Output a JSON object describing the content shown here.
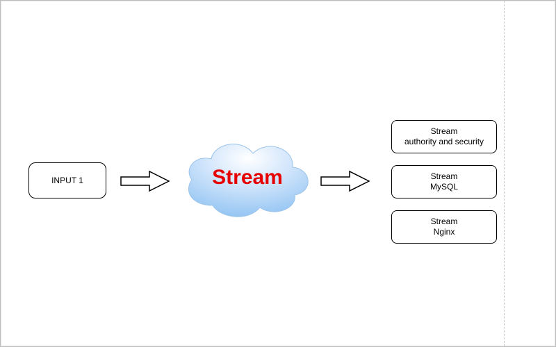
{
  "input": {
    "label": "INPUT 1"
  },
  "cloud": {
    "label": "Stream"
  },
  "outputs": [
    {
      "title": "Stream",
      "subtitle": "authority and security"
    },
    {
      "title": "Stream",
      "subtitle": "MySQL"
    },
    {
      "title": "Stream",
      "subtitle": "Nginx"
    }
  ]
}
